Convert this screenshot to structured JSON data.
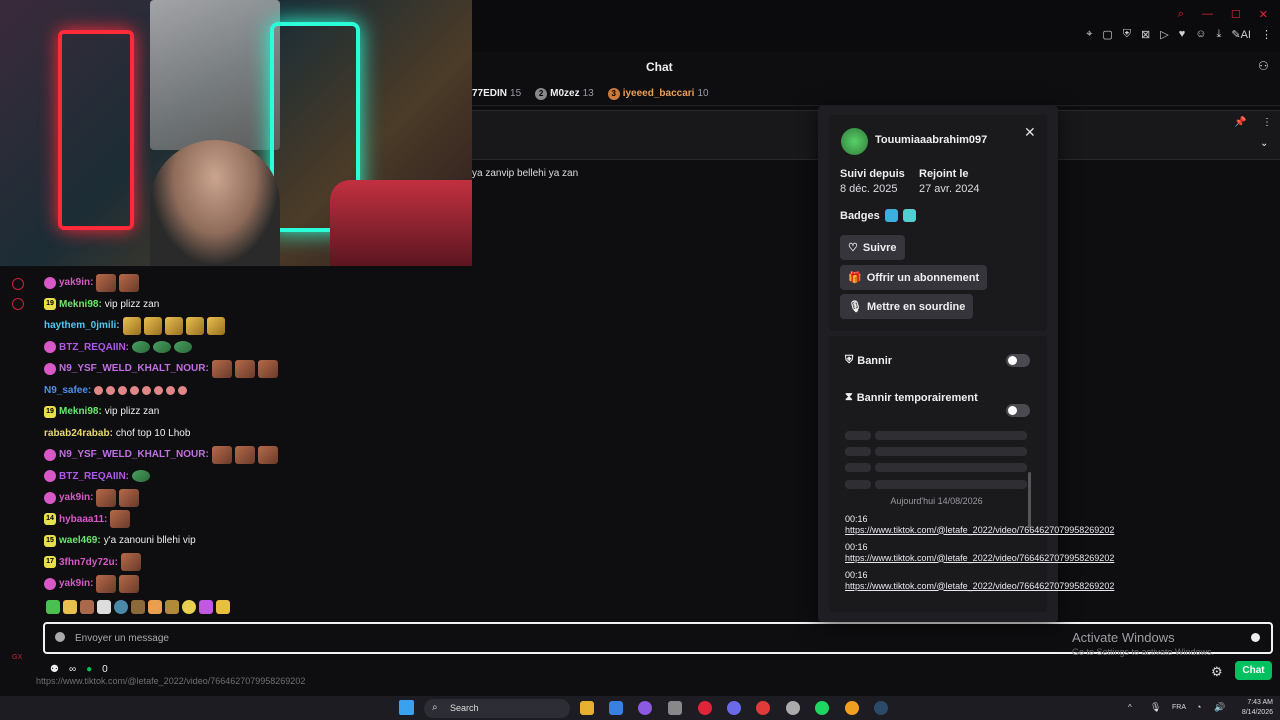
{
  "chat_header": {
    "title": "Chat"
  },
  "leaderboard": [
    {
      "rank": "",
      "name": "77EDIN",
      "count": "15"
    },
    {
      "rank": "2",
      "name": "M0zez",
      "count": "13"
    },
    {
      "rank": "3",
      "name": "iyeeed_baccari",
      "count": "10"
    }
  ],
  "top_message": "ya zanvip bellehi ya zan",
  "chat": [
    {
      "badge": "circle",
      "user": "yak9in:",
      "user_color": "#d858c8",
      "text": "",
      "emotes": "ee"
    },
    {
      "badge": "19",
      "badge_color": "#e8e04a",
      "user": "Mekni98:",
      "user_color": "#6ae86a",
      "text": "vip plizz zan",
      "emotes": ""
    },
    {
      "badge": "",
      "user": "haythem_0jmili:",
      "user_color": "#50c8f0",
      "text": "",
      "emotes": "ggggg"
    },
    {
      "badge": "circle",
      "user": "BTZ_REQAIIN:",
      "user_color": "#b058e8",
      "text": "",
      "emotes": "fff"
    },
    {
      "badge": "circle",
      "user": "N9_YSF_WELD_KHALT_NOUR:",
      "user_color": "#c070e0",
      "text": "",
      "emotes": "eee"
    },
    {
      "badge": "",
      "user": "N9_safee:",
      "user_color": "#5090e8",
      "text": "",
      "emotes": "dddddddd"
    },
    {
      "badge": "19",
      "badge_color": "#e8e04a",
      "user": "Mekni98:",
      "user_color": "#6ae86a",
      "text": "vip plizz zan",
      "emotes": ""
    },
    {
      "badge": "",
      "user": "rabab24rabab:",
      "user_color": "#e8d870",
      "text": "chof top 10 Lhob",
      "emotes": ""
    },
    {
      "badge": "circle",
      "user": "N9_YSF_WELD_KHALT_NOUR:",
      "user_color": "#c070e0",
      "text": "",
      "emotes": "eee"
    },
    {
      "badge": "circle",
      "user": "BTZ_REQAIIN:",
      "user_color": "#b058e8",
      "text": "",
      "emotes": "f"
    },
    {
      "badge": "circle",
      "user": "yak9in:",
      "user_color": "#d858c8",
      "text": "",
      "emotes": "ee"
    },
    {
      "badge": "14",
      "badge_color": "#e8e04a",
      "user": "hybaaa11:",
      "user_color": "#d858c8",
      "text": "",
      "emotes": "e"
    },
    {
      "badge": "15",
      "badge_color": "#e8e04a",
      "user": "wael469:",
      "user_color": "#6ae86a",
      "text": "y'a zanouni bllehi vip",
      "emotes": ""
    },
    {
      "badge": "17",
      "badge_color": "#e8e04a",
      "user": "3fhn7dy72u:",
      "user_color": "#d858c8",
      "text": "",
      "emotes": "e"
    },
    {
      "badge": "circle",
      "user": "yak9in:",
      "user_color": "#d858c8",
      "text": "",
      "emotes": "ee"
    }
  ],
  "input": {
    "placeholder": "Envoyer un message"
  },
  "footer": {
    "infinity": "∞",
    "points": "0",
    "url_tip": "https://www.tiktok.com/@letafe_2022/video/7664627079958269202",
    "chat_button": "Chat"
  },
  "windows_watermark": {
    "title": "Activate Windows",
    "subtitle": "Go to Settings to activate Windows."
  },
  "user_card": {
    "username": "Touumiaaabrahim097",
    "followed_label": "Suivi depuis",
    "followed_value": "8 déc. 2025",
    "joined_label": "Rejoint le",
    "joined_value": "27 avr. 2024",
    "badges_label": "Badges",
    "follow_button": "Suivre",
    "gift_button": "Offrir un abonnement",
    "mute_button": "Mettre en sourdine",
    "ban_label": "Bannir",
    "timeout_label": "Bannir temporairement",
    "today_label": "Aujourd'hui 14/08/2026",
    "logs": [
      {
        "time": "00:16",
        "link": "https://www.tiktok.com/@letafe_2022/video/7664627079958269202"
      },
      {
        "time": "00:16",
        "link": "https://www.tiktok.com/@letafe_2022/video/7664627079958269202"
      },
      {
        "time": "00:16",
        "link": "https://www.tiktok.com/@letafe_2022/video/7664627079958269202"
      }
    ]
  },
  "taskbar": {
    "search": "Search",
    "lang": "FRA",
    "time": "7:43 AM",
    "date": "8/14/2026"
  },
  "colors": {
    "accent": "#00c060",
    "brand_red": "#e0243a",
    "panel": "#1f1f23"
  }
}
